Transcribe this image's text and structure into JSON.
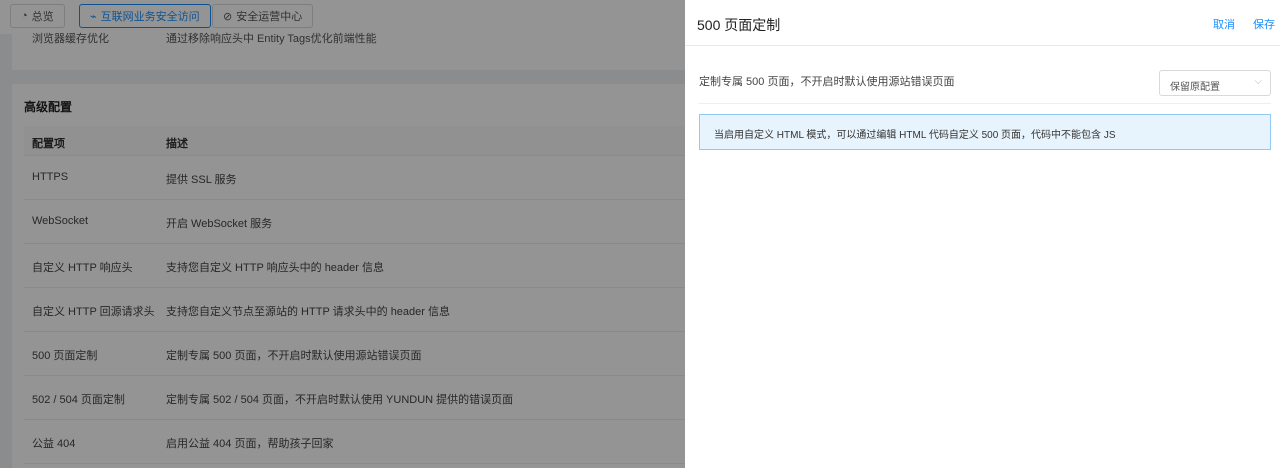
{
  "nav": {
    "tabs": [
      {
        "label": "总览",
        "active": false
      },
      {
        "label": "互联网业务安全访问",
        "active": true
      },
      {
        "label": "安全运营中心",
        "active": false
      }
    ]
  },
  "prev_card": {
    "name": "浏览器缓存优化",
    "desc": "通过移除响应头中 Entity Tags优化前端性能"
  },
  "advanced": {
    "title": "高级配置",
    "headers": [
      "配置项",
      "描述"
    ],
    "rows": [
      {
        "name": "HTTPS",
        "desc": "提供 SSL 服务"
      },
      {
        "name": "WebSocket",
        "desc": "开启 WebSocket 服务"
      },
      {
        "name": "自定义 HTTP 响应头",
        "desc": "支持您自定义 HTTP 响应头中的 header 信息"
      },
      {
        "name": "自定义 HTTP 回源请求头",
        "desc": "支持您自定义节点至源站的 HTTP 请求头中的 header 信息"
      },
      {
        "name": "500 页面定制",
        "desc": "定制专属 500 页面，不开启时默认使用源站错误页面"
      },
      {
        "name": "502 / 504 页面定制",
        "desc": "定制专属 502 / 504 页面，不开启时默认使用 YUNDUN 提供的错误页面"
      },
      {
        "name": "公益 404",
        "desc": "启用公益 404 页面，帮助孩子回家"
      }
    ]
  },
  "drawer": {
    "title": "500 页面定制",
    "cancel_label": "取消",
    "save_label": "保存",
    "setting_desc": "定制专属 500 页面，不开启时默认使用源站错误页面",
    "select_value": "保留原配置",
    "info_text": "当启用自定义 HTML 模式，可以通过编辑 HTML 代码自定义 500 页面，代码中不能包含 JS"
  },
  "colors": {
    "accent": "#1890ff",
    "info_bg": "#e8f4fd",
    "info_border": "#91caf5"
  },
  "icons": [
    "dashboard-icon",
    "link-icon",
    "shield-icon",
    "chevron-down-icon"
  ]
}
